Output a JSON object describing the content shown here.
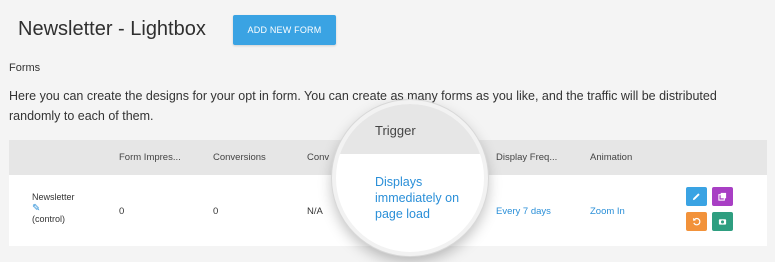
{
  "header": {
    "title": "Newsletter - Lightbox",
    "add_button_label": "ADD NEW FORM"
  },
  "section": {
    "label": "Forms",
    "intro": "Here you can create the designs for your opt in form. You can create as many forms as you like, and the traffic will be distributed randomly to each of them."
  },
  "table": {
    "columns": [
      "Form Impres...",
      "Conversions",
      "Conv",
      "Display Freq...",
      "Animation"
    ],
    "rows": [
      {
        "name": "Newsletter",
        "variant": "(control)",
        "impressions": "0",
        "conversions": "0",
        "conversion_rate": "N/A",
        "frequency": "Every 7 days",
        "animation": "Zoom In"
      }
    ]
  },
  "magnifier": {
    "column": "Trigger",
    "value": "Displays immediately on page load"
  },
  "actions": {
    "colors": {
      "edit": "#3aa3e3",
      "duplicate": "#a83fc4",
      "reset": "#f2923a",
      "stats": "#2e9e80"
    },
    "icons": [
      "pencil-icon",
      "copy-icon",
      "undo-icon",
      "camera-icon"
    ]
  },
  "colors": {
    "accent": "#3aa3e3",
    "link": "#2a8fd8",
    "header_bg": "#e6e6e6",
    "page_bg": "#f4f4f4"
  }
}
